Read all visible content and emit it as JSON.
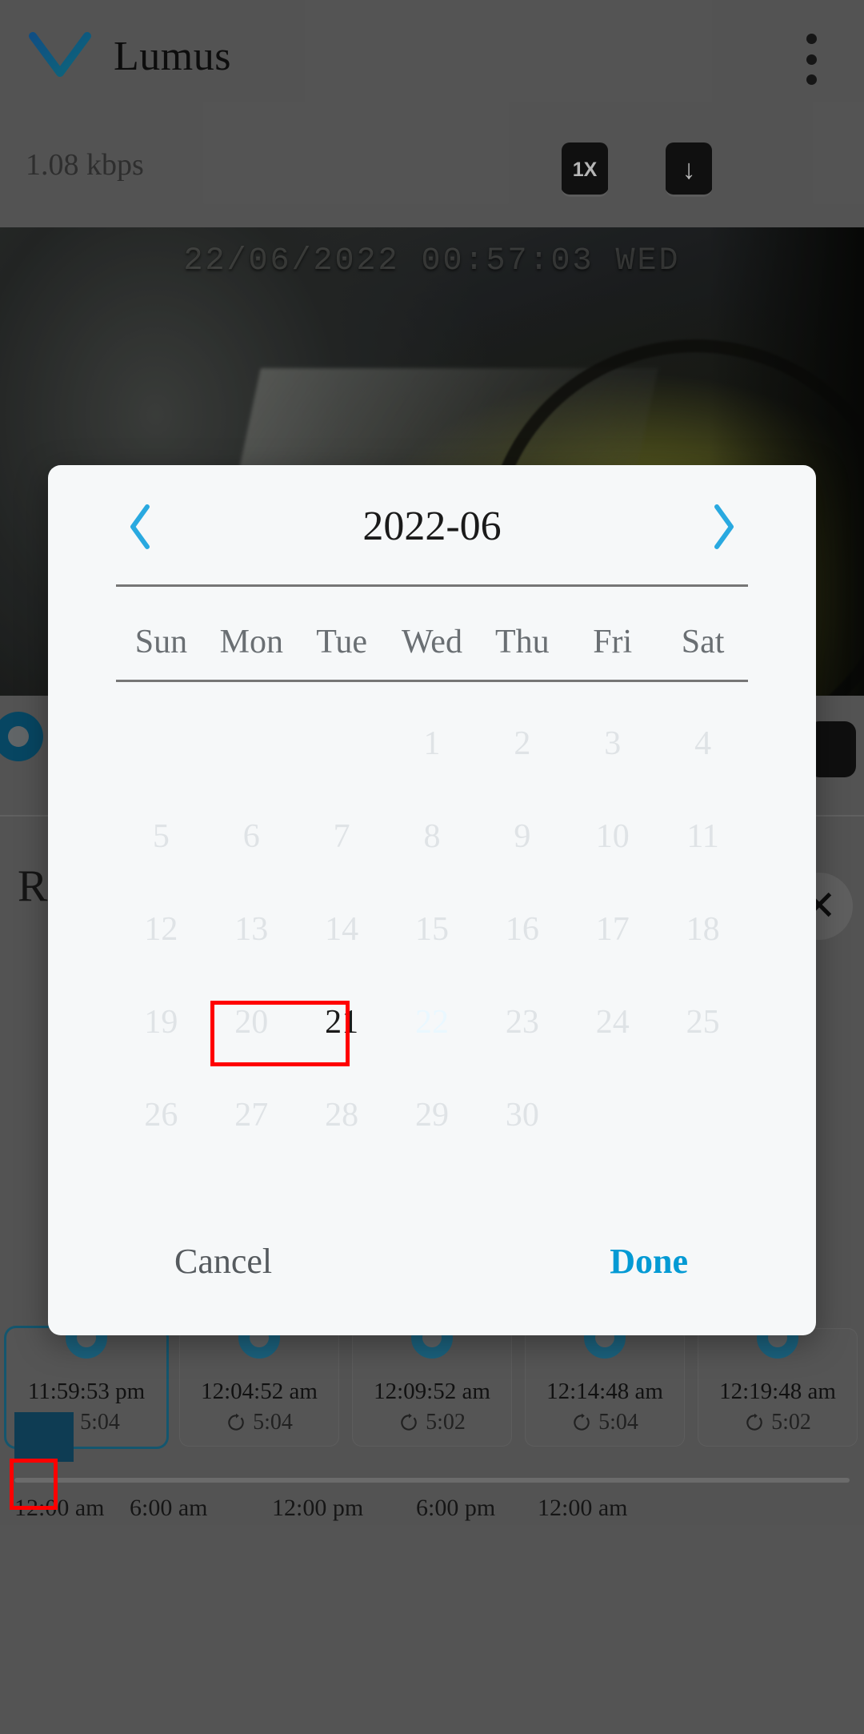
{
  "appbar": {
    "title": "Lumus",
    "back_icon": "chevron-down-icon",
    "overflow_icon": "more-vertical-icon"
  },
  "status": {
    "bitrate": "1.08 kbps",
    "speed_button": "1X",
    "download_icon": "↓"
  },
  "video": {
    "overlay_timestamp": "22/06/2022 00:57:03 WED",
    "play_icon": "play-icon"
  },
  "panel": {
    "label": "R",
    "close_icon": "✕"
  },
  "dialog": {
    "title": "2022-06",
    "prev_icon": "‹",
    "next_icon": "›",
    "weekdays": [
      "Sun",
      "Mon",
      "Tue",
      "Wed",
      "Thu",
      "Fri",
      "Sat"
    ],
    "leading_blanks": 3,
    "days": [
      {
        "n": "1",
        "state": "disabled"
      },
      {
        "n": "2",
        "state": "disabled"
      },
      {
        "n": "3",
        "state": "disabled"
      },
      {
        "n": "4",
        "state": "disabled"
      },
      {
        "n": "5",
        "state": "disabled"
      },
      {
        "n": "6",
        "state": "disabled"
      },
      {
        "n": "7",
        "state": "disabled"
      },
      {
        "n": "8",
        "state": "disabled"
      },
      {
        "n": "9",
        "state": "disabled"
      },
      {
        "n": "10",
        "state": "disabled"
      },
      {
        "n": "11",
        "state": "disabled"
      },
      {
        "n": "12",
        "state": "disabled"
      },
      {
        "n": "13",
        "state": "disabled"
      },
      {
        "n": "14",
        "state": "disabled"
      },
      {
        "n": "15",
        "state": "disabled"
      },
      {
        "n": "16",
        "state": "disabled"
      },
      {
        "n": "17",
        "state": "disabled"
      },
      {
        "n": "18",
        "state": "disabled"
      },
      {
        "n": "19",
        "state": "disabled"
      },
      {
        "n": "20",
        "state": "disabled"
      },
      {
        "n": "21",
        "state": "enabled"
      },
      {
        "n": "22",
        "state": "selected"
      },
      {
        "n": "23",
        "state": "disabled"
      },
      {
        "n": "24",
        "state": "disabled"
      },
      {
        "n": "25",
        "state": "disabled"
      },
      {
        "n": "26",
        "state": "disabled"
      },
      {
        "n": "27",
        "state": "disabled"
      },
      {
        "n": "28",
        "state": "disabled"
      },
      {
        "n": "29",
        "state": "disabled"
      },
      {
        "n": "30",
        "state": "disabled"
      }
    ],
    "cancel_label": "Cancel",
    "done_label": "Done"
  },
  "thumbnails": [
    {
      "time": "11:59:53 pm",
      "duration": "5:04",
      "selected": true
    },
    {
      "time": "12:04:52 am",
      "duration": "5:04",
      "selected": false
    },
    {
      "time": "12:09:52 am",
      "duration": "5:02",
      "selected": false
    },
    {
      "time": "12:14:48 am",
      "duration": "5:04",
      "selected": false
    },
    {
      "time": "12:19:48 am",
      "duration": "5:02",
      "selected": false
    }
  ],
  "timeline": {
    "labels": [
      "12:00 am",
      "6:00 am",
      "12:00 pm",
      "6:00 pm",
      "12:00 am"
    ],
    "label_positions": [
      18,
      162,
      340,
      520,
      672
    ]
  },
  "colors": {
    "accent": "#039ad4",
    "annotation": "#ff0000",
    "dialog_bg": "#f6f8f9",
    "scrim_bg": "#6b6b6b",
    "timeline_block": "#134d6b"
  }
}
